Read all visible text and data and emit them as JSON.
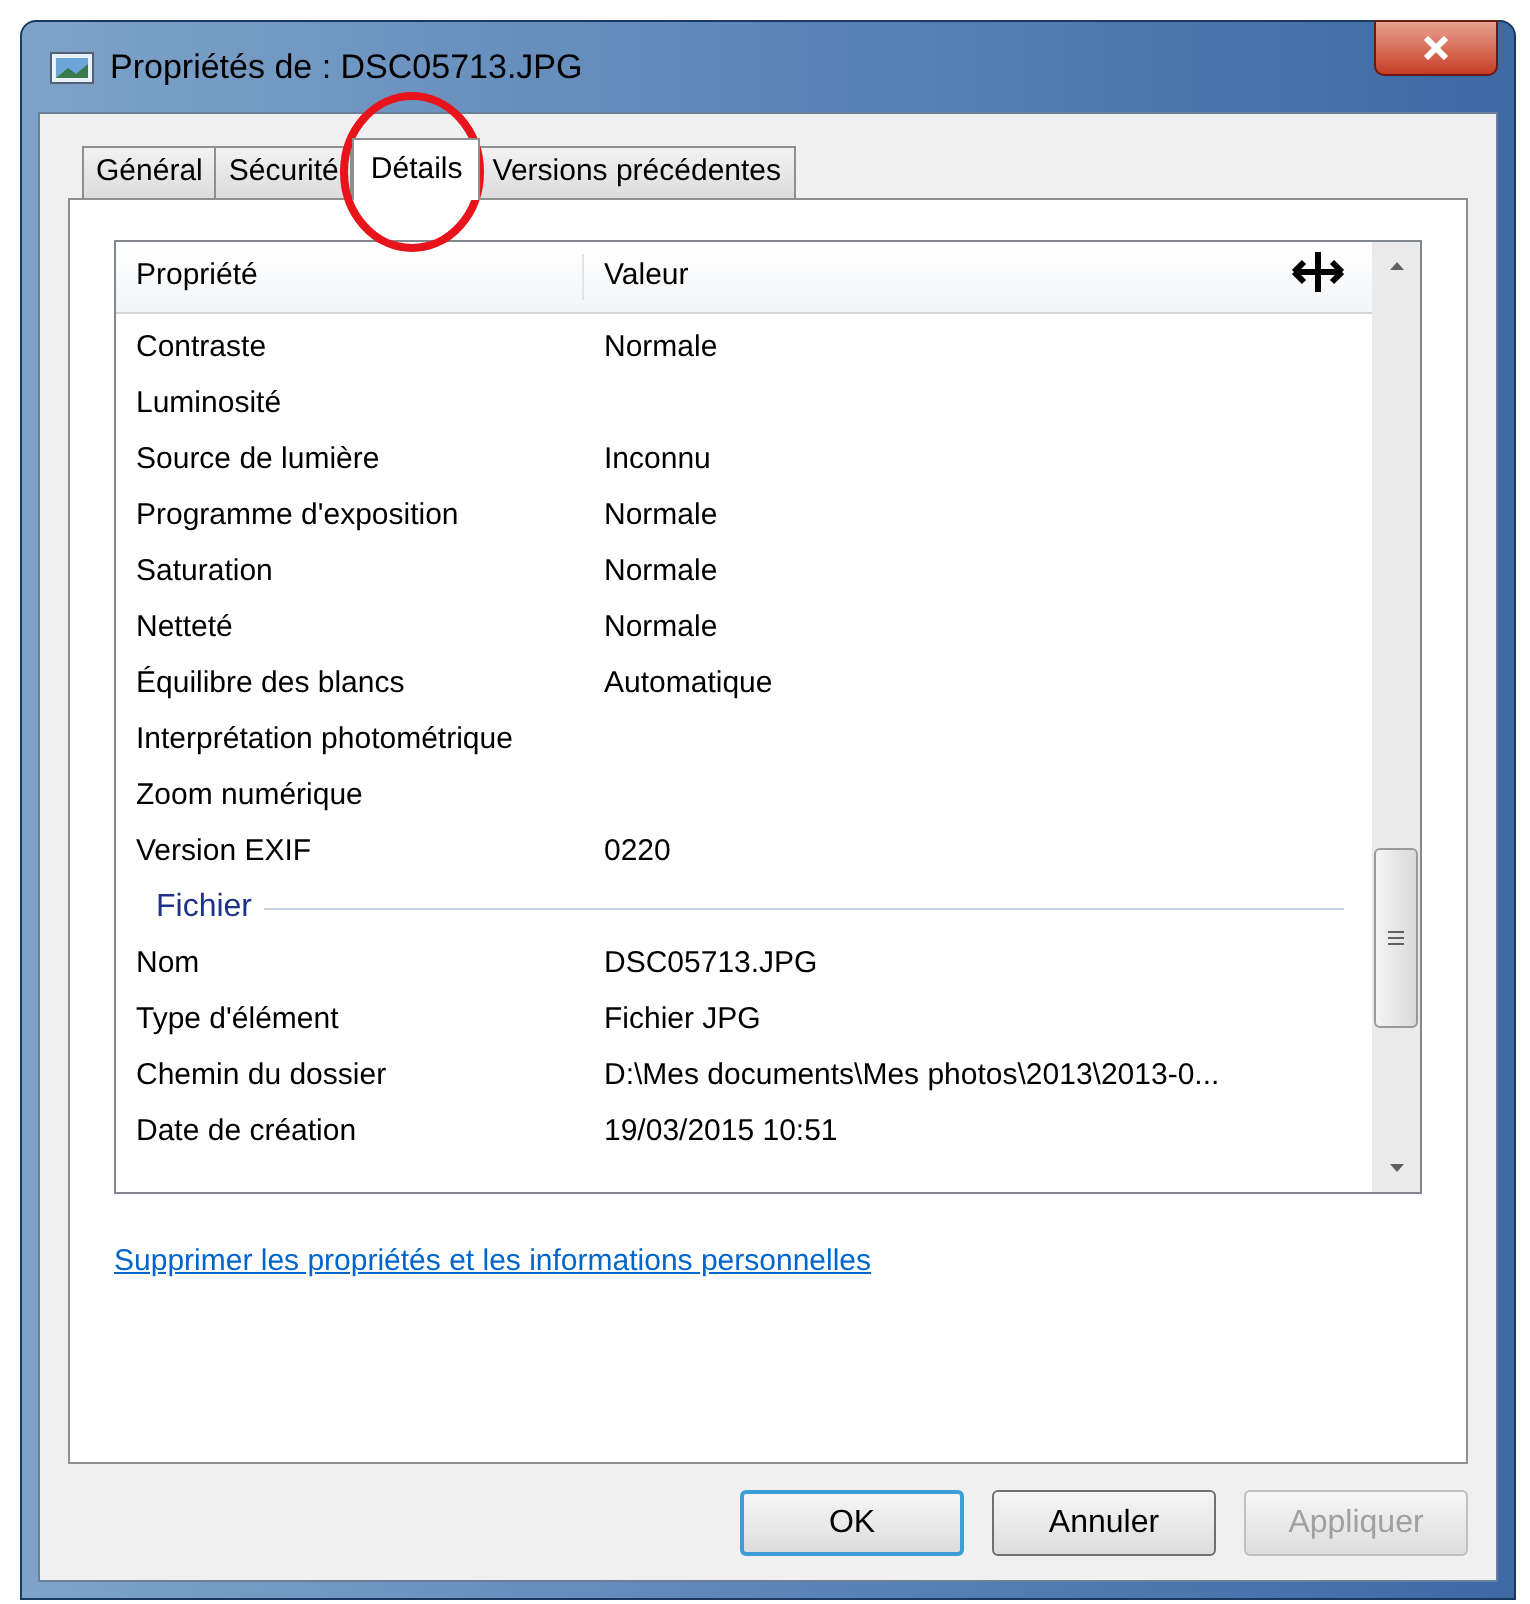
{
  "window": {
    "title": "Propriétés de : DSC05713.JPG"
  },
  "tabs": [
    {
      "label": "Général",
      "selected": false
    },
    {
      "label": "Sécurité",
      "selected": false
    },
    {
      "label": "Détails",
      "selected": true
    },
    {
      "label": "Versions précédentes",
      "selected": false
    }
  ],
  "table": {
    "columns": [
      "Propriété",
      "Valeur"
    ],
    "rows": [
      {
        "kind": "row",
        "property": "Contraste",
        "value": "Normale"
      },
      {
        "kind": "row",
        "property": "Luminosité",
        "value": ""
      },
      {
        "kind": "row",
        "property": "Source de lumière",
        "value": "Inconnu"
      },
      {
        "kind": "row",
        "property": "Programme d'exposition",
        "value": "Normale"
      },
      {
        "kind": "row",
        "property": "Saturation",
        "value": "Normale"
      },
      {
        "kind": "row",
        "property": "Netteté",
        "value": "Normale"
      },
      {
        "kind": "row",
        "property": "Équilibre des blancs",
        "value": "Automatique"
      },
      {
        "kind": "row",
        "property": "Interprétation photométrique",
        "value": ""
      },
      {
        "kind": "row",
        "property": "Zoom numérique",
        "value": ""
      },
      {
        "kind": "row",
        "property": "Version EXIF",
        "value": "0220"
      },
      {
        "kind": "group",
        "property": "Fichier"
      },
      {
        "kind": "row",
        "property": "Nom",
        "value": "DSC05713.JPG"
      },
      {
        "kind": "row",
        "property": "Type d'élément",
        "value": "Fichier JPG"
      },
      {
        "kind": "row",
        "property": "Chemin du dossier",
        "value": "D:\\Mes documents\\Mes photos\\2013\\2013-0..."
      },
      {
        "kind": "row",
        "property": "Date de création",
        "value": "19/03/2015 10:51"
      }
    ]
  },
  "link": "Supprimer les propriétés et les informations personnelles",
  "buttons": [
    {
      "label": "OK",
      "default": true,
      "disabled": false
    },
    {
      "label": "Annuler",
      "default": false,
      "disabled": false
    },
    {
      "label": "Appliquer",
      "default": false,
      "disabled": true
    }
  ]
}
